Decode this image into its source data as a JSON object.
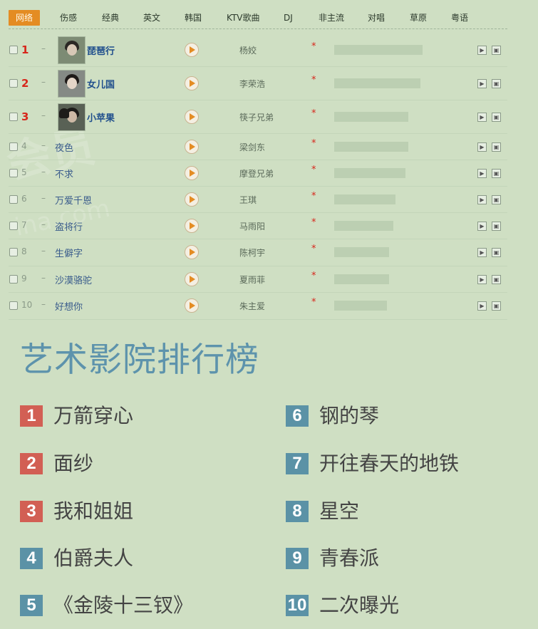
{
  "tabs": [
    "网络",
    "伤感",
    "经典",
    "英文",
    "韩国",
    "KTV歌曲",
    "DJ",
    "非主流",
    "对唱",
    "草原",
    "粤语"
  ],
  "songs": [
    {
      "rank": "1",
      "title": "琵琶行",
      "singer": "杨姣",
      "star": "*",
      "bar": 0.95,
      "thumb": true
    },
    {
      "rank": "2",
      "title": "女儿国",
      "singer": "李荣浩",
      "star": "*",
      "bar": 0.93,
      "thumb": true
    },
    {
      "rank": "3",
      "title": "小苹果",
      "singer": "筷子兄弟",
      "star": "*",
      "bar": 0.8,
      "thumb": true
    },
    {
      "rank": "4",
      "title": "夜色",
      "singer": "梁剑东",
      "star": "*",
      "bar": 0.8,
      "thumb": false
    },
    {
      "rank": "5",
      "title": "不求",
      "singer": "摩登兄弟",
      "star": "*",
      "bar": 0.77,
      "thumb": false
    },
    {
      "rank": "6",
      "title": "万爱千恩",
      "singer": "王琪",
      "star": "*",
      "bar": 0.66,
      "thumb": false
    },
    {
      "rank": "7",
      "title": "盗将行",
      "singer": "马雨阳",
      "star": "*",
      "bar": 0.64,
      "thumb": false
    },
    {
      "rank": "8",
      "title": "生僻字",
      "singer": "陈柯宇",
      "star": "*",
      "bar": 0.59,
      "thumb": false
    },
    {
      "rank": "9",
      "title": "沙漠骆驼",
      "singer": "夏雨菲",
      "star": "*",
      "bar": 0.59,
      "thumb": false
    },
    {
      "rank": "10",
      "title": "好想你",
      "singer": "朱主爱",
      "star": "*",
      "bar": 0.57,
      "thumb": false
    }
  ],
  "mini_icons": {
    "play": "▶",
    "download": "▣"
  },
  "chart": {
    "title": "艺术影院排行榜",
    "items": [
      {
        "num": "1",
        "title": "万箭穿心"
      },
      {
        "num": "2",
        "title": "面纱"
      },
      {
        "num": "3",
        "title": "我和姐姐"
      },
      {
        "num": "4",
        "title": "伯爵夫人"
      },
      {
        "num": "5",
        "title": "《金陵十三钗》"
      },
      {
        "num": "6",
        "title": "钢的琴"
      },
      {
        "num": "7",
        "title": "开往春天的地铁"
      },
      {
        "num": "8",
        "title": "星空"
      },
      {
        "num": "9",
        "title": "青春派"
      },
      {
        "num": "10",
        "title": "二次曝光"
      }
    ]
  },
  "watermark": {
    "main": "会员",
    "sub": "ina.com"
  },
  "colors": {
    "accent": "#e48c23",
    "red": "#d25f54",
    "blue": "#5b92a6",
    "title_blue": "#5d93ac"
  }
}
